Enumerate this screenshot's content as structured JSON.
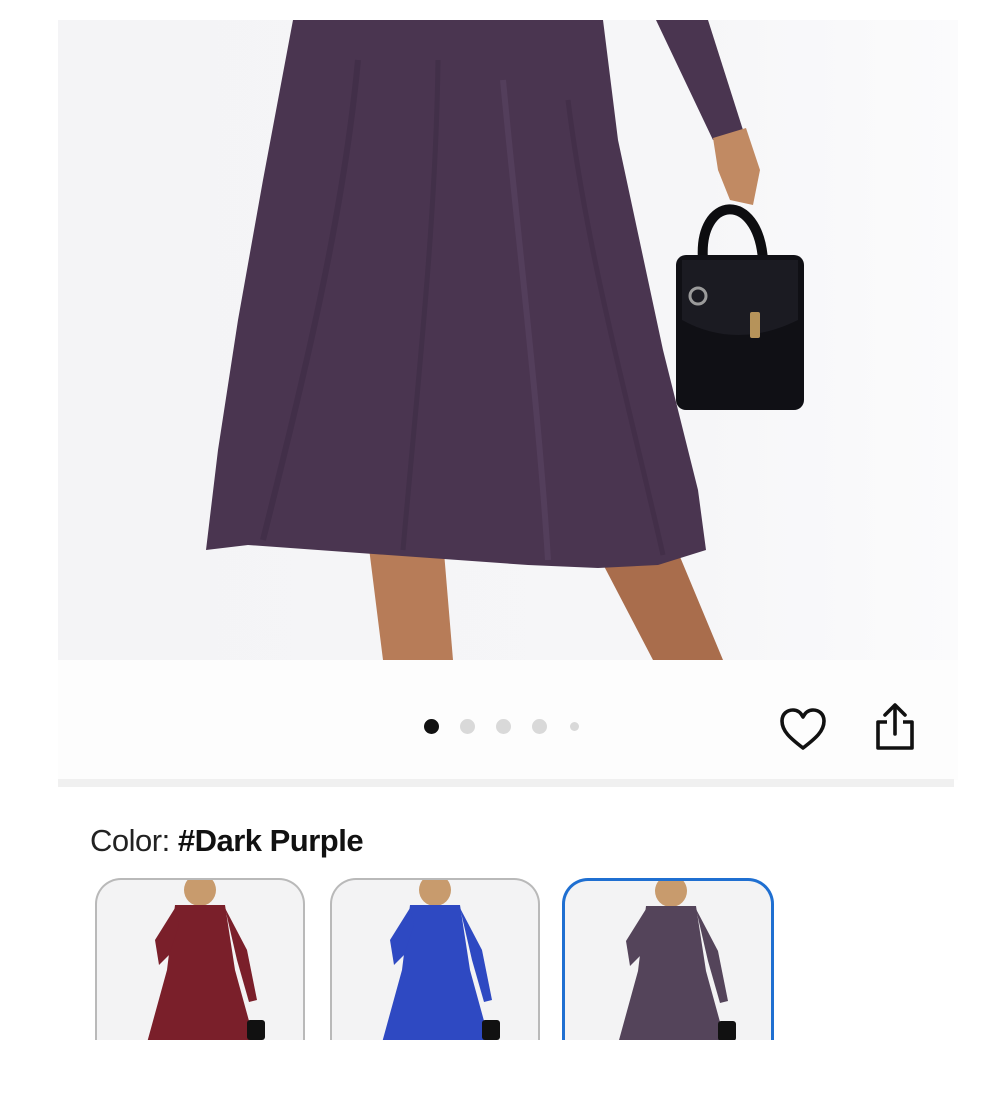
{
  "product_image": {
    "alt": ""
  },
  "gallery": {
    "dot_count": 5,
    "active_index": 0
  },
  "actions": {
    "favorite_icon": "heart-icon",
    "share_icon": "share-icon"
  },
  "color_selector": {
    "label": "Color:",
    "selected_value": "#Dark Purple",
    "swatches": [
      {
        "color_hex": "#7a1f2a",
        "selected": false
      },
      {
        "color_hex": "#2e49c2",
        "selected": false
      },
      {
        "color_hex": "#54445a",
        "selected": true
      }
    ]
  },
  "colors": {
    "accent": "#1f6fd1",
    "dress": "#4a3550"
  }
}
